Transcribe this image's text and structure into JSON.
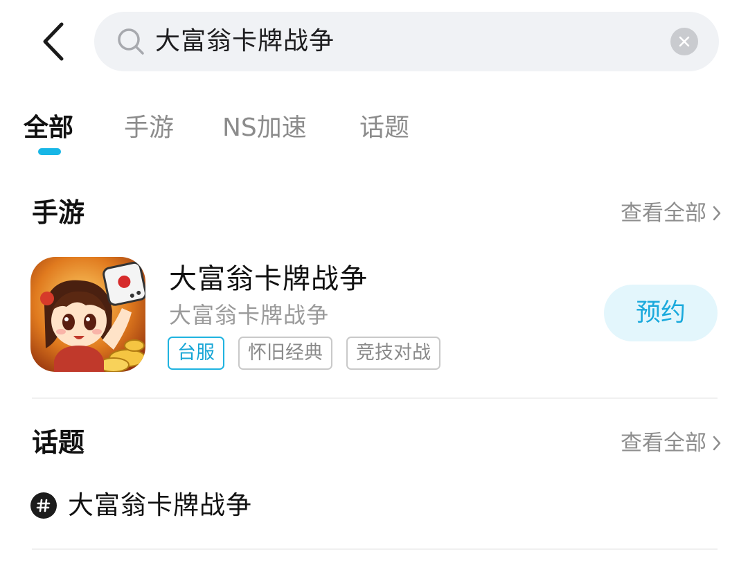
{
  "search": {
    "query": "大富翁卡牌战争"
  },
  "tabs": [
    {
      "label": "全部",
      "active": true
    },
    {
      "label": "手游",
      "active": false
    },
    {
      "label": "NS加速",
      "active": false
    },
    {
      "label": "话题",
      "active": false
    }
  ],
  "games_section": {
    "title": "手游",
    "view_all": "查看全部",
    "items": [
      {
        "name": "大富翁卡牌战争",
        "subtitle": "大富翁卡牌战争",
        "tags": [
          "台服",
          "怀旧经典",
          "竞技对战"
        ],
        "action": "预约"
      }
    ]
  },
  "topics_section": {
    "title": "话题",
    "view_all": "查看全部",
    "items": [
      {
        "label": "大富翁卡牌战争"
      }
    ]
  },
  "colors": {
    "accent": "#17b6e6",
    "reserve_bg": "#e3f6fc",
    "search_bg": "#f0f2f5"
  }
}
